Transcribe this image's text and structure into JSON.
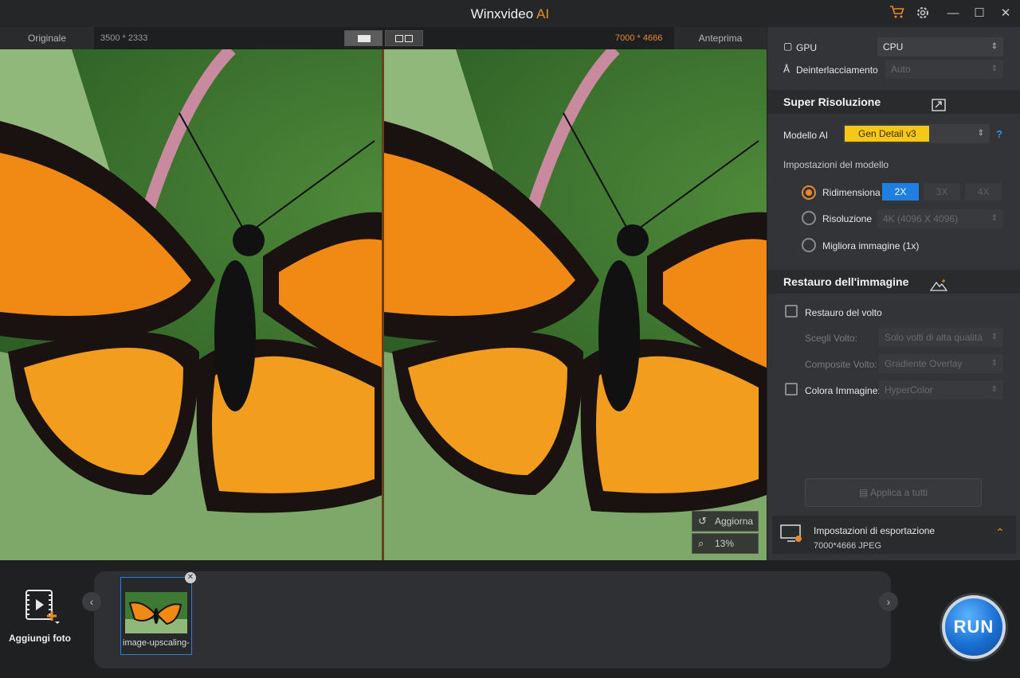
{
  "app": {
    "title": "Winxvideo",
    "title_ai": "AI"
  },
  "titlebar": {
    "cart_icon": "cart-icon",
    "settings_icon": "gear-icon",
    "minimize": "—",
    "maximize": "☐",
    "close": "✕"
  },
  "preview_header": {
    "original_label": "Originale",
    "original_size": "3500 * 2333",
    "preview_size": "7000 * 4666",
    "preview_label": "Anteprima"
  },
  "preview_overlay": {
    "refresh_label": "Aggiorna",
    "zoom_label": "13%"
  },
  "panel": {
    "gpu_label": "GPU",
    "gpu_value": "CPU",
    "deinterlace_label": "Deinterlacciamento",
    "deinterlace_value": "Auto",
    "super_res": {
      "title": "Super Risoluzione",
      "model_label": "Modello AI",
      "model_value": "Gen Detail v3",
      "help": "?",
      "settings_label": "Impostazioni del modello",
      "resize_label": "Ridimensiona",
      "scale_options": [
        "2X",
        "3X",
        "4X"
      ],
      "resolution_label": "Risoluzione",
      "resolution_value": "4K (4096 X 4096)",
      "enhance_label": "Migliora immagine (1x)"
    },
    "restore": {
      "title": "Restauro dell'immagine",
      "face_label": "Restauro del volto",
      "choose_face_label": "Scegli Volto:",
      "choose_face_value": "Solo volti di alta qualità",
      "composite_label": "Composite Volto:",
      "composite_value": "Gradiente Overlay",
      "color_label": "Colora Immagine:",
      "color_value": "HyperColor"
    },
    "apply_all": "Applica a tutti",
    "export": {
      "title": "Impostazioni di esportazione",
      "details": "7000*4666  JPEG"
    }
  },
  "bottom": {
    "add_photo": "Aggiungi foto",
    "thumb_caption": "image-upscaling-",
    "run": "RUN"
  },
  "colors": {
    "accent": "#e88a2c",
    "blue": "#1e7fe0",
    "yellow": "#f5c817"
  }
}
